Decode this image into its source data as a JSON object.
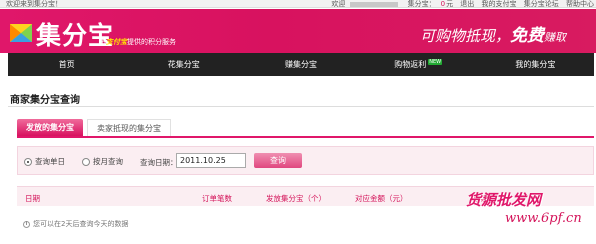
{
  "topbar": {
    "welcome_left": "欢迎来到集分宝！",
    "welcome_right": "欢迎",
    "points_label": "集分宝：",
    "points_value": "0",
    "points_unit": "元",
    "logout": "退出",
    "my_alipay": "我的支付宝",
    "forum": "集分宝论坛",
    "help": "帮助中心"
  },
  "header": {
    "logo_text": "集分宝",
    "logo_sub_prefix": "由",
    "logo_sub_brand": "支付宝",
    "logo_sub_suffix": "提供的积分服务",
    "slogan_part1": "可购物抵现，",
    "slogan_part2": "免费",
    "slogan_part3": "赚取"
  },
  "nav": {
    "items": [
      {
        "label": "首页"
      },
      {
        "label": "花集分宝"
      },
      {
        "label": "赚集分宝"
      },
      {
        "label": "购物返利",
        "badge": "NEW"
      },
      {
        "label": "我的集分宝"
      }
    ]
  },
  "page": {
    "title": "商家集分宝查询"
  },
  "tabs": [
    {
      "label": "发放的集分宝",
      "active": true
    },
    {
      "label": "卖家抵现的集分宝",
      "active": false
    }
  ],
  "query": {
    "radio_day": "查询单日",
    "radio_month": "按月查询",
    "date_label": "查询日期：",
    "date_value": "2011.10.25",
    "button": "查询"
  },
  "table": {
    "headers": [
      "日期",
      "订单笔数",
      "发放集分宝（个）",
      "对应金额（元）",
      "手续费"
    ],
    "empty_message": "您可以在2天后查询今天的数据"
  },
  "watermark": {
    "text": "货源批发网",
    "url": "www.6pf.cn"
  },
  "colors": {
    "brand": "#d8125f",
    "nav_bg": "#222222",
    "panel_bg": "#fbeef2"
  }
}
